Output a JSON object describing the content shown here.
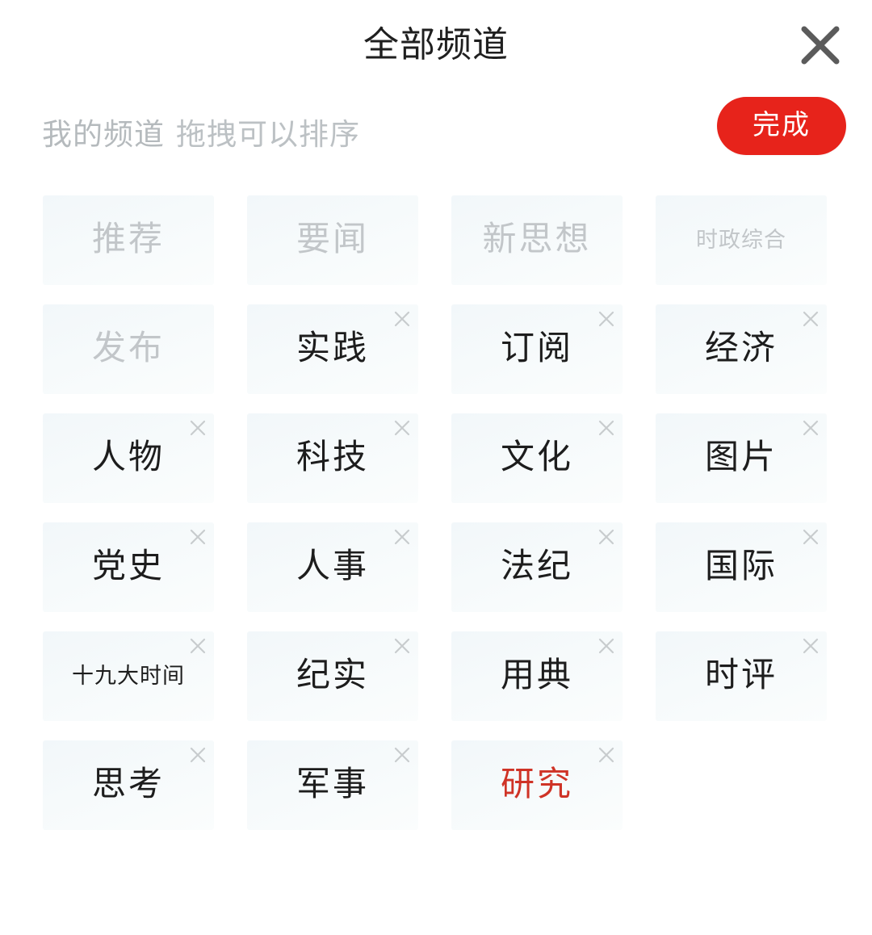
{
  "header": {
    "title": "全部频道",
    "close_icon": "close-icon"
  },
  "my_channels": {
    "section_label": "我的频道",
    "drag_hint": "拖拽可以排序",
    "done_label": "完成",
    "done_color": "#e7231b",
    "active_color": "#cf3326",
    "fixed_color": "#c2c6c9",
    "tile_bg": "#f4f9fa",
    "items": [
      {
        "label": "推荐",
        "removable": false,
        "state": "fixed"
      },
      {
        "label": "要闻",
        "removable": false,
        "state": "fixed"
      },
      {
        "label": "新思想",
        "removable": false,
        "state": "fixed"
      },
      {
        "label": "时政综合",
        "removable": false,
        "state": "fixed",
        "small": true
      },
      {
        "label": "发布",
        "removable": false,
        "state": "fixed"
      },
      {
        "label": "实践",
        "removable": true,
        "state": "normal"
      },
      {
        "label": "订阅",
        "removable": true,
        "state": "normal"
      },
      {
        "label": "经济",
        "removable": true,
        "state": "normal"
      },
      {
        "label": "人物",
        "removable": true,
        "state": "normal"
      },
      {
        "label": "科技",
        "removable": true,
        "state": "normal"
      },
      {
        "label": "文化",
        "removable": true,
        "state": "normal"
      },
      {
        "label": "图片",
        "removable": true,
        "state": "normal"
      },
      {
        "label": "党史",
        "removable": true,
        "state": "normal"
      },
      {
        "label": "人事",
        "removable": true,
        "state": "normal"
      },
      {
        "label": "法纪",
        "removable": true,
        "state": "normal"
      },
      {
        "label": "国际",
        "removable": true,
        "state": "normal"
      },
      {
        "label": "十九大时间",
        "removable": true,
        "state": "normal",
        "small": true
      },
      {
        "label": "纪实",
        "removable": true,
        "state": "normal"
      },
      {
        "label": "用典",
        "removable": true,
        "state": "normal"
      },
      {
        "label": "时评",
        "removable": true,
        "state": "normal"
      },
      {
        "label": "思考",
        "removable": true,
        "state": "normal"
      },
      {
        "label": "军事",
        "removable": true,
        "state": "normal"
      },
      {
        "label": "研究",
        "removable": true,
        "state": "active"
      },
      {
        "label": "",
        "removable": false,
        "state": "empty"
      }
    ]
  }
}
